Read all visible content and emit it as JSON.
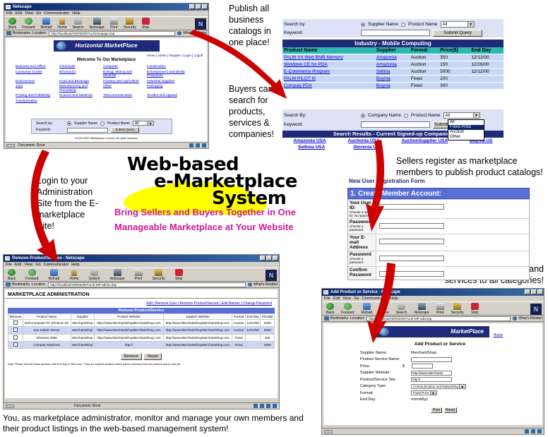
{
  "captions": {
    "publish": "Publish all business catalogs in one place!",
    "buyers": "Buyers can search for products, services & companies!",
    "register": "Sellers register as marketplace members to publish product catalogs!",
    "login": "Login to your Administration Site from the E-marketplace Site!",
    "add_products": "Sellers can add new products and services to all categories!",
    "admin": "You, as marketplace administrator, monitor and manage your own members and their product listings in the web-based management system!"
  },
  "center": {
    "line1": "Web-based",
    "line2": "e-Marketplace",
    "line3": "System",
    "tagline1": "Bring Sellers and Buyers Together in One",
    "tagline2": "Manageable Marketplace at Your Website"
  },
  "colors": {
    "arrow_red": "#cc0000",
    "tagline_magenta": "#cc1a99",
    "header_navy": "#1f2b7a",
    "table_teal": "#2fb8b0",
    "yellow_blob": "#ffff00"
  },
  "browser": {
    "menu": [
      "File",
      "Edit",
      "View",
      "Go",
      "Communicator",
      "Help"
    ],
    "toolbar": [
      "Back",
      "Forward",
      "Reload",
      "Home",
      "Search",
      "Netscape",
      "Print",
      "Security",
      "Stop"
    ],
    "bookmarks": "Bookmarks",
    "location_label": "Location:",
    "whats_related": "What's Related",
    "status": "Document: Done"
  },
  "home_window": {
    "title": "Netscape",
    "url": "http://localhost/HORIZONTAL/homepage.asp",
    "banner": "Horizontal MarketPlace",
    "top_links": "Home | Admin | Register | Login | Logoff",
    "welcome": "Welcome To Our Marketplace",
    "categories": [
      [
        "Business and Office",
        "Chemicals",
        "Computer",
        "Construction"
      ],
      [
        "Consumer Goods",
        "Electronics",
        "Energy, Mining and Minerals",
        "Entertainment and Media Production"
      ],
      [
        "Environment",
        "Food and Beverage",
        "Forestry and Agriculture",
        "Industrial Supplies"
      ],
      [
        "Jobs",
        "Manufacturing and Processing",
        "Other",
        "Packaging"
      ],
      [
        "Printing and Publishing",
        "Science and Medicine",
        "Telecommunication",
        "Textiles and Apparel"
      ],
      [
        "Transportation",
        "",
        "",
        ""
      ]
    ],
    "search_label": "Search by:",
    "opt_supplier": "Supplier Name",
    "opt_product": "Product Name",
    "select_value": "All",
    "keyword_label": "Keyword:",
    "submit": "Submit Query",
    "copyright": "©2000-2002 Marketplace Country. All rights reserved."
  },
  "product_search": {
    "search_label": "Search by:",
    "opt_supplier": "Supplier Name",
    "opt_product": "Product Name",
    "select_value": "All",
    "keyword_label": "Keyword:",
    "submit": "Submit Query",
    "table_title": "Industry - Mobile Computing",
    "headers": [
      "Product Name",
      "Supplier",
      "Format",
      "Price($)",
      "End Day"
    ],
    "rows": [
      [
        "PALM VX Web BMB Memory",
        "Amazonia",
        "Auction",
        "350",
        "12/12/00"
      ],
      [
        "Windows CE for PDA",
        "Amazonia",
        "Auction",
        "150",
        "12/26/00"
      ],
      [
        "E-Commerce Program",
        "Sellnia",
        "Auction",
        "5000",
        "12/12/00"
      ],
      [
        "PALM PILOT III",
        "Buynia",
        "Fixed",
        "200",
        ""
      ],
      [
        "Compaq PDA",
        "Buynia",
        "Fixed",
        "300",
        ""
      ]
    ]
  },
  "company_search": {
    "search_label": "Search By:",
    "opt_company": "Company Name",
    "opt_product": "Product Name",
    "select_value": "All",
    "keyword_label": "Keyword:",
    "submit": "Submit",
    "dropdown_options": [
      "All",
      "Fixed Price",
      "Auction",
      "Other"
    ],
    "results_title": "Search Results - Current Signed-up Companies",
    "companies_row1": [
      "Amazonia USA",
      "Auctionia USA",
      "AuctionSupplier USA",
      "Buynia US"
    ],
    "companies_row2": [
      "Sellinia USA",
      "Storenia USA"
    ]
  },
  "registration": {
    "title": "New User Registration Form",
    "section": "1. Create Member Account:",
    "fields": [
      {
        "label": "Your User ID:",
        "hint": "Choose a user ID. No spacing."
      },
      {
        "label": "Password",
        "hint": "Choose a password"
      },
      {
        "label": "Your E-mail Address",
        "hint": ""
      },
      {
        "label": "Password",
        "hint": "Choose a password"
      },
      {
        "label": "Confirm Password",
        "hint": ""
      }
    ]
  },
  "admin_window": {
    "title": "Remove Product/Service - Netscape",
    "url": "http://localhost/HORIZONTAL/E-MP-admin.asp",
    "header": "MARKETPLACE ADMINISTRATION",
    "nav": "Edit | Remove User | Remove Product/Service | Edit Banner | Change Password",
    "table_title": "Remove Product/Service",
    "headers": [
      "Remove",
      "Product Name",
      "Supplier",
      "Product Website",
      "Supplier Website",
      "Format",
      "End Day",
      "Price($)"
    ],
    "rows": [
      [
        "Dell Computer PC (Pentium III)",
        "MerchantShop",
        "http://www.MerchantShopMerchantShop.com",
        "http://www.MerchantShopMerchantShop.com",
        "Auction",
        "12/12/00",
        "2000"
      ],
      [
        "Sun Solaris Server",
        "MerchantShop",
        "http://www.MerchantShopMerchantShop.com",
        "http://www.MerchantShopMerchantShop.com",
        "Auction",
        "12/12/00",
        "5000"
      ],
      [
        "Windows 2000",
        "MerchantShop",
        "http://www.MerchantShopMerchantShop.com",
        "http://www.MerchantShopMerchantShop.com",
        "Fixed",
        "",
        "300"
      ],
      [
        "Compaq Notebook",
        "MerchantShop",
        "http://",
        "http://www.MerchantShopMerchantShop.com",
        "Fixed",
        "",
        "1800"
      ]
    ],
    "remove_btn": "Remove",
    "reset_btn": "Reset",
    "note": "Note: Please remove those auctions with End Day in Red color. They are expired auctions which will be removed from the product search pick list."
  },
  "add_window": {
    "title": "Add Product or Service - Netscape",
    "url": "http://localhost/HORIZONTAL/E-MP-add.asp",
    "banner": "MarketPlace",
    "home_link": "Home",
    "heading": "Add Product or Service",
    "fields": [
      {
        "label": "Supplier Name:",
        "value": "MerchantShop",
        "kind": "text"
      },
      {
        "label": "Product Service Name:",
        "value": "",
        "kind": "input"
      },
      {
        "label": "Price:",
        "value": "",
        "kind": "price"
      },
      {
        "label": "Supplier Website:",
        "value": "http://www.Merchants",
        "kind": "input"
      },
      {
        "label": "Product/Service Site:",
        "value": "http://",
        "kind": "input"
      },
      {
        "label": "Category Type:",
        "value": "Communication and Networking",
        "kind": "select"
      },
      {
        "label": "Format:",
        "value": "Fixed Price",
        "kind": "select"
      },
      {
        "label": "End Day:",
        "value": "mm/dd/yy",
        "kind": "text"
      }
    ],
    "price_symbol": "$",
    "post_btn": "Post",
    "reset_btn": "Reset"
  }
}
